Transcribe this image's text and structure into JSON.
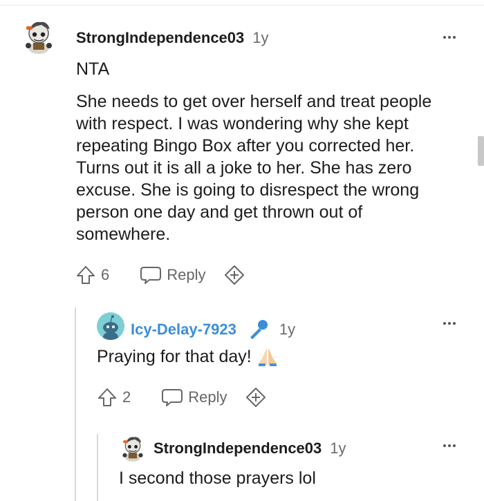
{
  "comments": [
    {
      "username": "StrongIndependence03",
      "age": "1y",
      "lines": [
        "NTA"
      ],
      "body": [
        "She needs to get over herself and treat people",
        "with respect. I was wondering why she kept",
        "repeating Bingo Box after you corrected her.",
        "Turns out it is all a joke to her. She has zero",
        "excuse. She is going to disrespect the wrong",
        "person one day and get thrown out of",
        "somewhere."
      ],
      "upvotes": "6",
      "reply_label": "Reply"
    },
    {
      "username": "Icy-Delay-7923",
      "age": "1y",
      "text": "Praying for that day!",
      "upvotes": "2",
      "reply_label": "Reply"
    },
    {
      "username": "StrongIndependence03",
      "age": "1y",
      "text": "I second those prayers lol"
    }
  ],
  "colors": {
    "link_blue": "#3b8ed8",
    "muted": "#6b6b6b",
    "thread_line": "#d9d9d9"
  },
  "icons": [
    "upvote-icon",
    "reply-bubble-icon",
    "award-plus-icon",
    "more-options-icon",
    "microphone-icon",
    "praying-hands-emoji"
  ]
}
